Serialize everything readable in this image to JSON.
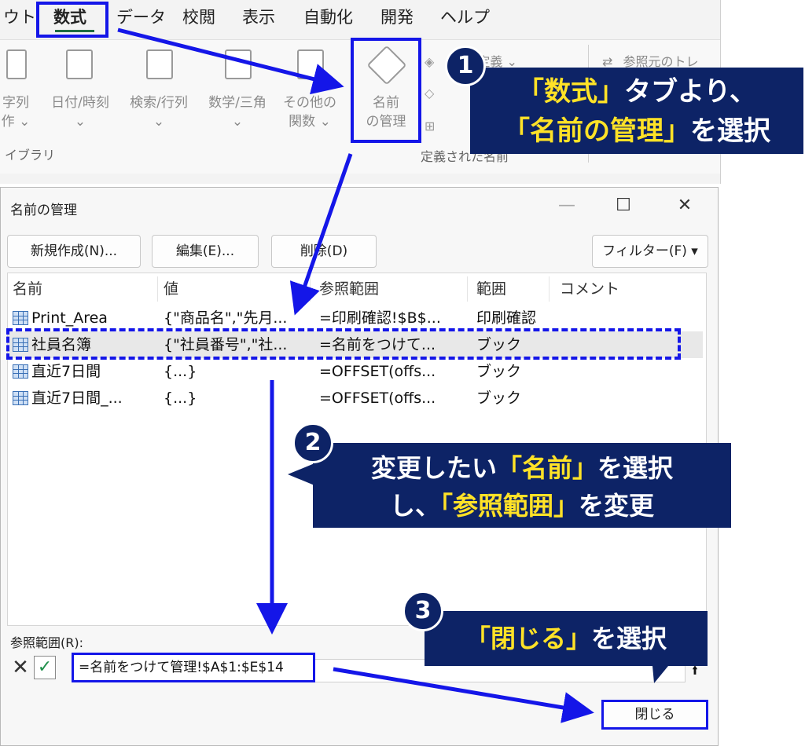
{
  "ribbon": {
    "tabs": [
      {
        "label": "ウト"
      },
      {
        "label": "数式"
      },
      {
        "label": "データ"
      },
      {
        "label": "校閲"
      },
      {
        "label": "表示"
      },
      {
        "label": "自動化"
      },
      {
        "label": "開発"
      },
      {
        "label": "ヘルプ"
      }
    ],
    "buttons": {
      "text_line1": "字列",
      "text_line2": "作 ⌄",
      "datetime_line1": "日付/時刻",
      "datetime_line2": "⌄",
      "lookup_line1": "検索/行列",
      "lookup_line2": "⌄",
      "math_line1": "数学/三角",
      "math_line2": "⌄",
      "other_line1": "その他の",
      "other_line2": "関数 ⌄",
      "name_manager_line1": "名前",
      "name_manager_line2": "の管理"
    },
    "define_name_label": "の定義  ⌄",
    "trace_precedents_label": "参照元のトレ",
    "group_library": "イブラリ",
    "group_defined_names": "定義された名前"
  },
  "dialog": {
    "title": "名前の管理",
    "minimize": "—",
    "maximize": "☐",
    "close": "✕",
    "buttons": {
      "new": "新規作成(N)...",
      "edit": "編集(E)...",
      "delete": "削除(D)",
      "filter": "フィルター(F) ▾"
    },
    "columns": [
      "名前",
      "値",
      "参照範囲",
      "範囲",
      "コメント"
    ],
    "rows": [
      {
        "name": "Print_Area",
        "value": "{\"商品名\",\"先月...",
        "refers_to": "=印刷確認!$B$...",
        "scope": "印刷確認",
        "comment": ""
      },
      {
        "name": "社員名簿",
        "value": "{\"社員番号\",\"社...",
        "refers_to": "=名前をつけて...",
        "scope": "ブック",
        "comment": ""
      },
      {
        "name": "直近7日間",
        "value": "{...}",
        "refers_to": "=OFFSET(offs...",
        "scope": "ブック",
        "comment": ""
      },
      {
        "name": "直近7日間_...",
        "value": "{...}",
        "refers_to": "=OFFSET(offs...",
        "scope": "ブック",
        "comment": ""
      }
    ],
    "ref_label": "参照範囲(R):",
    "ref_value": "=名前をつけて管理!$A$1:$E$14",
    "cancel_glyph": "✕",
    "ok_glyph": "✓",
    "collapse_glyph": "⭱",
    "close_button": "閉じる"
  },
  "annotations": {
    "step1": {
      "badge": "1",
      "line1_y": "「数式」",
      "line1": "タブより、",
      "line2_y": "「名前の管理」",
      "line2": "を選択"
    },
    "step2": {
      "badge": "2",
      "line1_a": "変更したい",
      "line1_y": "「名前」",
      "line1_b": "を選択",
      "line2_a": "し、",
      "line2_y": "「参照範囲」",
      "line2_b": "を変更"
    },
    "step3": {
      "badge": "3",
      "line_y": "「閉じる」",
      "line": "を選択"
    }
  },
  "colors": {
    "highlight": "#1416e8",
    "callout_bg": "#0d2366",
    "callout_accent": "#ffe227"
  }
}
